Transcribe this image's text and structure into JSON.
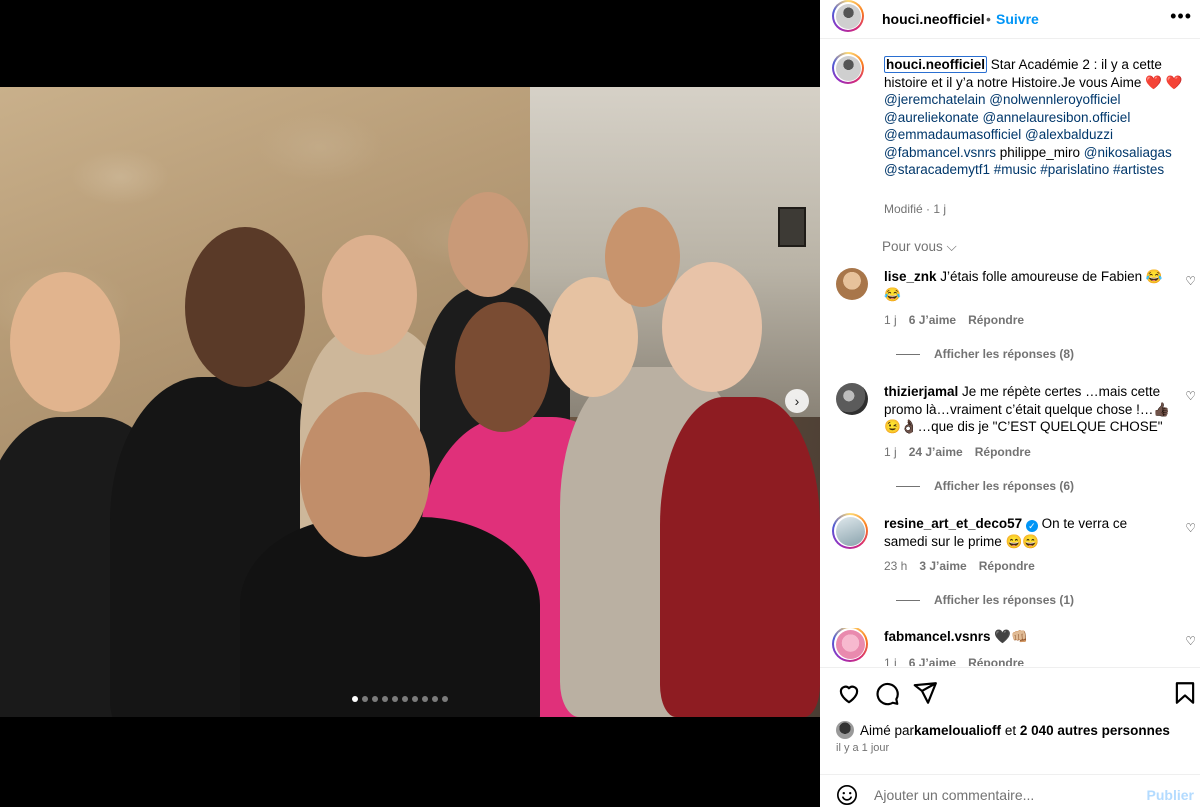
{
  "post": {
    "username": "houci.neofficiel",
    "separator": "•",
    "follow_label": "Suivre",
    "more_label": "•••"
  },
  "caption": {
    "username": "houci.neofficiel",
    "text_1": " Star Académie 2 : il y a cette histoire et il y’a notre Histoire.Je vous Aime ❤️ ❤️ ",
    "tags_1": "@jeremchatelain @nolwennleroyofficiel @aureliekonate @annelauresibon.officiel @emmadaumasofficiel @alexbalduzzi @fabmancel.vsnrs",
    "plain_1": " philippe_miro ",
    "tags_2": "@nikosaliagas @staracademytf1 #music #parislatino #artistes",
    "meta": "Modifié · 1 j"
  },
  "filter_label": "Pour vous ⌵",
  "comments": [
    {
      "user": "lise_znk",
      "text": " J’étais folle amoureuse de Fabien 😂😂",
      "time": "1 j",
      "likes": "6 J’aime",
      "reply": "Répondre",
      "replies": "Afficher les réponses (8)",
      "avatar_color": "#c79a6a"
    },
    {
      "user": "thizierjamal",
      "text": " Je me répète certes …mais cette promo là…vraiment c’était quelque chose !…👍🏿😉👌🏿…que dis je \"C’EST QUELQUE CHOSE\"",
      "time": "1 j",
      "likes": "24 J’aime",
      "reply": "Répondre",
      "replies": "Afficher les réponses (6)",
      "avatar_color": "#6d6d6d"
    },
    {
      "user": "resine_art_et_deco57",
      "text": " On te verra ce samedi sur le prime 😄😄",
      "time": "23 h",
      "likes": "3 J’aime",
      "reply": "Répondre",
      "replies": "Afficher les réponses (1)",
      "avatar_color": "#8fa9b5"
    },
    {
      "user": "fabmancel.vsnrs",
      "text": " 🖤👊🏼",
      "time": "1 j",
      "likes": "6 J’aime",
      "reply": "Répondre",
      "avatar_color": "#f4a7c3"
    }
  ],
  "likes": {
    "prefix": "Aimé par ",
    "user": "kamelouali off",
    "user_display": "kameloualioff",
    "middle": " et ",
    "count": "2 040 autres personnes"
  },
  "time_ago": "il y a 1 jour",
  "comment_input": {
    "placeholder": "Ajouter un commentaire...",
    "submit_label": "Publier"
  },
  "carousel": {
    "next_label": "›",
    "total_slides": 10,
    "active_slide": 1
  },
  "colors": {
    "link": "#00376b",
    "follow": "#0095f6",
    "muted": "#737373",
    "publish_disabled": "#b3dbff"
  },
  "icons": [
    "heart-icon",
    "comment-icon",
    "share-icon",
    "bookmark-icon",
    "emoji-icon",
    "more-icon",
    "verified-icon",
    "chevron-right-icon"
  ]
}
